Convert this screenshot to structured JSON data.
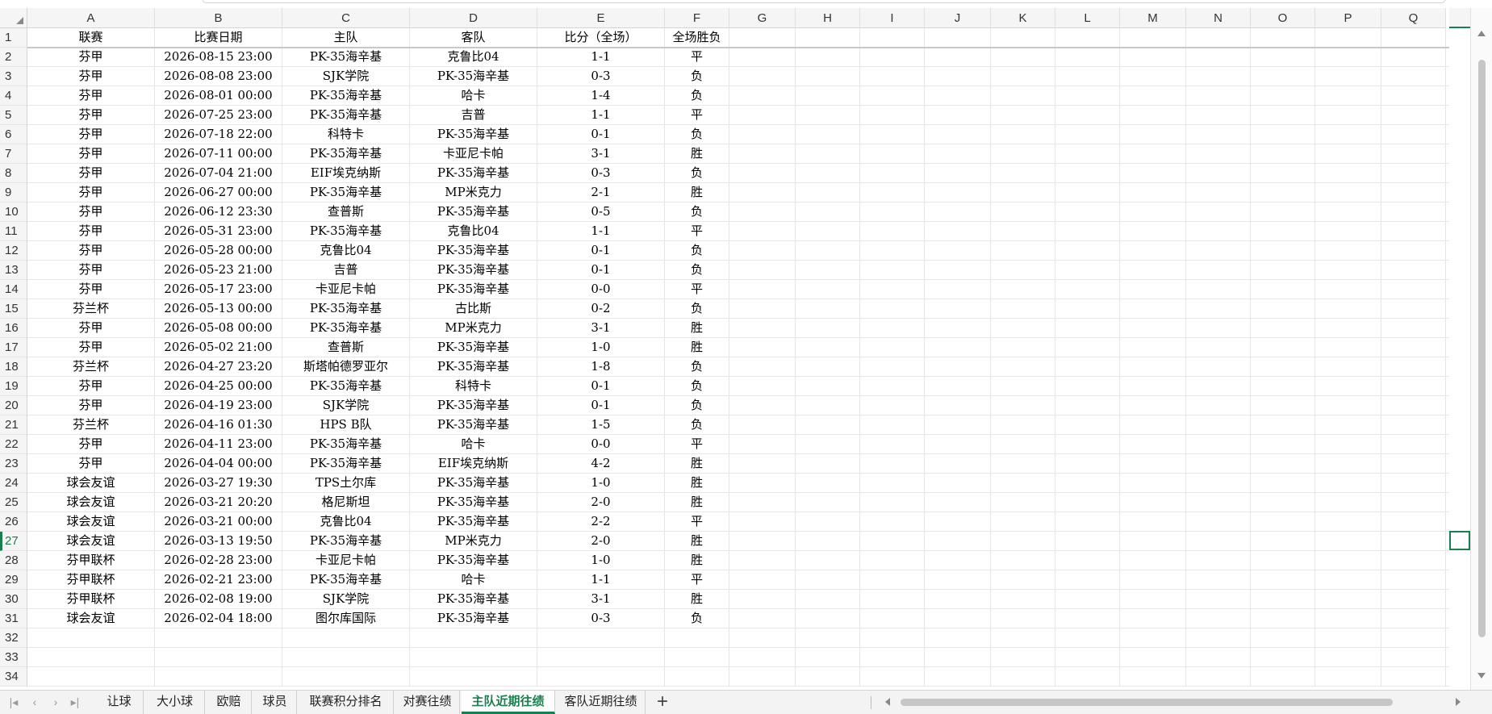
{
  "columns": [
    "A",
    "B",
    "C",
    "D",
    "E",
    "F",
    "G",
    "H",
    "I",
    "J",
    "K",
    "L",
    "M",
    "N",
    "O",
    "P",
    "Q"
  ],
  "header_row": [
    "联赛",
    "比赛日期",
    "主队",
    "客队",
    "比分（全场）",
    "全场胜负"
  ],
  "rows": [
    [
      "芬甲",
      "2026-08-15 23:00",
      "PK-35海辛基",
      "克鲁比04",
      "1-1",
      "平"
    ],
    [
      "芬甲",
      "2026-08-08 23:00",
      "SJK学院",
      "PK-35海辛基",
      "0-3",
      "负"
    ],
    [
      "芬甲",
      "2026-08-01 00:00",
      "PK-35海辛基",
      "哈卡",
      "1-4",
      "负"
    ],
    [
      "芬甲",
      "2026-07-25 23:00",
      "PK-35海辛基",
      "吉普",
      "1-1",
      "平"
    ],
    [
      "芬甲",
      "2026-07-18 22:00",
      "科特卡",
      "PK-35海辛基",
      "0-1",
      "负"
    ],
    [
      "芬甲",
      "2026-07-11 00:00",
      "PK-35海辛基",
      "卡亚尼卡帕",
      "3-1",
      "胜"
    ],
    [
      "芬甲",
      "2026-07-04 21:00",
      "EIF埃克纳斯",
      "PK-35海辛基",
      "0-3",
      "负"
    ],
    [
      "芬甲",
      "2026-06-27 00:00",
      "PK-35海辛基",
      "MP米克力",
      "2-1",
      "胜"
    ],
    [
      "芬甲",
      "2026-06-12 23:30",
      "查普斯",
      "PK-35海辛基",
      "0-5",
      "负"
    ],
    [
      "芬甲",
      "2026-05-31 23:00",
      "PK-35海辛基",
      "克鲁比04",
      "1-1",
      "平"
    ],
    [
      "芬甲",
      "2026-05-28 00:00",
      "克鲁比04",
      "PK-35海辛基",
      "0-1",
      "负"
    ],
    [
      "芬甲",
      "2026-05-23 21:00",
      "吉普",
      "PK-35海辛基",
      "0-1",
      "负"
    ],
    [
      "芬甲",
      "2026-05-17 23:00",
      "卡亚尼卡帕",
      "PK-35海辛基",
      "0-0",
      "平"
    ],
    [
      "芬兰杯",
      "2026-05-13 00:00",
      "PK-35海辛基",
      "古比斯",
      "0-2",
      "负"
    ],
    [
      "芬甲",
      "2026-05-08 00:00",
      "PK-35海辛基",
      "MP米克力",
      "3-1",
      "胜"
    ],
    [
      "芬甲",
      "2026-05-02 21:00",
      "查普斯",
      "PK-35海辛基",
      "1-0",
      "胜"
    ],
    [
      "芬兰杯",
      "2026-04-27 23:20",
      "斯塔帕德罗亚尔",
      "PK-35海辛基",
      "1-8",
      "负"
    ],
    [
      "芬甲",
      "2026-04-25 00:00",
      "PK-35海辛基",
      "科特卡",
      "0-1",
      "负"
    ],
    [
      "芬甲",
      "2026-04-19 23:00",
      "SJK学院",
      "PK-35海辛基",
      "0-1",
      "负"
    ],
    [
      "芬兰杯",
      "2026-04-16 01:30",
      "HPS B队",
      "PK-35海辛基",
      "1-5",
      "负"
    ],
    [
      "芬甲",
      "2026-04-11 23:00",
      "PK-35海辛基",
      "哈卡",
      "0-0",
      "平"
    ],
    [
      "芬甲",
      "2026-04-04 00:00",
      "PK-35海辛基",
      "EIF埃克纳斯",
      "4-2",
      "胜"
    ],
    [
      "球会友谊",
      "2026-03-27 19:30",
      "TPS土尔库",
      "PK-35海辛基",
      "1-0",
      "胜"
    ],
    [
      "球会友谊",
      "2026-03-21 20:20",
      "格尼斯坦",
      "PK-35海辛基",
      "2-0",
      "胜"
    ],
    [
      "球会友谊",
      "2026-03-21 00:00",
      "克鲁比04",
      "PK-35海辛基",
      "2-2",
      "平"
    ],
    [
      "球会友谊",
      "2026-03-13 19:50",
      "PK-35海辛基",
      "MP米克力",
      "2-0",
      "胜"
    ],
    [
      "芬甲联杯",
      "2026-02-28 23:00",
      "卡亚尼卡帕",
      "PK-35海辛基",
      "1-0",
      "胜"
    ],
    [
      "芬甲联杯",
      "2026-02-21 23:00",
      "PK-35海辛基",
      "哈卡",
      "1-1",
      "平"
    ],
    [
      "芬甲联杯",
      "2026-02-08 19:00",
      "SJK学院",
      "PK-35海辛基",
      "3-1",
      "胜"
    ],
    [
      "球会友谊",
      "2026-02-04 18:00",
      "图尔库国际",
      "PK-35海辛基",
      "0-3",
      "负"
    ]
  ],
  "row_numbers": [
    "1",
    "2",
    "3",
    "4",
    "5",
    "6",
    "7",
    "8",
    "9",
    "10",
    "11",
    "12",
    "13",
    "14",
    "15",
    "16",
    "17",
    "18",
    "19",
    "20",
    "21",
    "22",
    "23",
    "24",
    "25",
    "26",
    "27",
    "28",
    "29",
    "30",
    "31",
    "32",
    "33",
    "34"
  ],
  "active_row": "27",
  "sheet_tabs": [
    "让球",
    "大小球",
    "欧赔",
    "球员",
    "联赛积分排名",
    "对赛往绩",
    "主队近期往绩",
    "客队近期往绩"
  ],
  "active_tab": "主队近期往绩",
  "add_tab_label": "+",
  "nav_icons": [
    "first-sheet-icon",
    "prev-sheet-icon",
    "next-sheet-icon",
    "last-sheet-icon"
  ],
  "accent_color": "#1a7f4e"
}
